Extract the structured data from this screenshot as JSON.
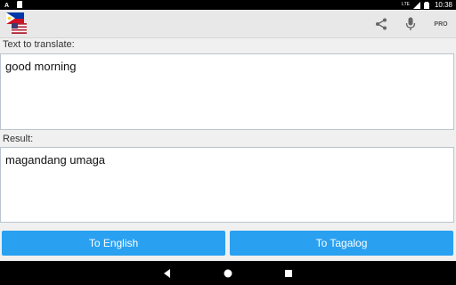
{
  "status_bar": {
    "time": "10:38",
    "network": "LTE"
  },
  "toolbar": {
    "pro_label": "PRO"
  },
  "input": {
    "label": "Text to translate:",
    "value": "good morning"
  },
  "result": {
    "label": "Result:",
    "value": "magandang umaga"
  },
  "buttons": {
    "to_english": "To English",
    "to_tagalog": "To Tagalog"
  },
  "colors": {
    "button": "#29a0f0",
    "toolbar": "#e8e8e8",
    "background": "#f0f0f0"
  }
}
